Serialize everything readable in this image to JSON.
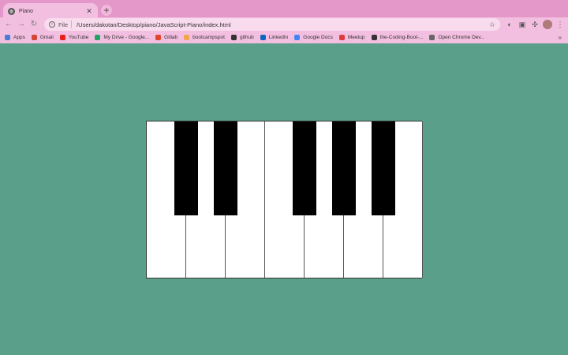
{
  "browser": {
    "tab_title": "Piano",
    "tab_icon": "globe-icon",
    "url_scheme": "File",
    "url": "/Users/dakotan/Desktop/piano/JavaScript-Piano/index.html"
  },
  "bookmarks": [
    {
      "label": "Apps",
      "icon": "apps-grid-icon",
      "color": "#4a7bd6"
    },
    {
      "label": "Gmail",
      "icon": "gmail-icon",
      "color": "#d44638"
    },
    {
      "label": "YouTube",
      "icon": "youtube-icon",
      "color": "#e62117"
    },
    {
      "label": "My Drive - Google...",
      "icon": "drive-icon",
      "color": "#1fa463"
    },
    {
      "label": "Gitlab",
      "icon": "gitlab-icon",
      "color": "#e24329"
    },
    {
      "label": "bootcampspot",
      "icon": "bootcampspot-icon",
      "color": "#f0a64e"
    },
    {
      "label": "github",
      "icon": "github-icon",
      "color": "#333333"
    },
    {
      "label": "LinkedIn",
      "icon": "linkedin-icon",
      "color": "#0a66c2"
    },
    {
      "label": "Google Docs",
      "icon": "docs-icon",
      "color": "#4285f4"
    },
    {
      "label": "Meetup",
      "icon": "meetup-icon",
      "color": "#e0393e"
    },
    {
      "label": "the-Coding-Boot-...",
      "icon": "github-icon",
      "color": "#333333"
    },
    {
      "label": "Open Chrome Dev...",
      "icon": "devtools-icon",
      "color": "#666666"
    }
  ],
  "piano": {
    "white_keys": 7,
    "black_keys_after_white_index": [
      0,
      1,
      3,
      4,
      5
    ],
    "colors": {
      "background": "#5a9f8a",
      "white": "#ffffff",
      "black": "#000000"
    }
  }
}
